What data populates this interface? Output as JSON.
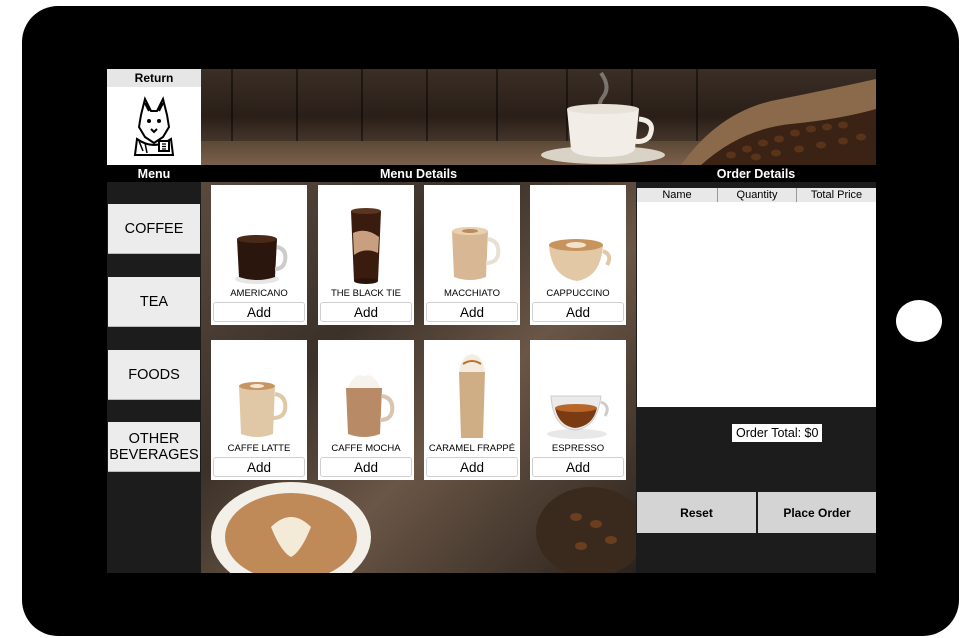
{
  "top": {
    "return_label": "Return"
  },
  "headers": {
    "menu": "Menu",
    "menu_details": "Menu Details",
    "order_details": "Order Details"
  },
  "categories": [
    "COFFEE",
    "TEA",
    "FOODS",
    "OTHER BEVERAGES"
  ],
  "items": [
    {
      "name": "AMERICANO",
      "add": "Add"
    },
    {
      "name": "THE BLACK TIE",
      "add": "Add"
    },
    {
      "name": "MACCHIATO",
      "add": "Add"
    },
    {
      "name": "CAPPUCCINO",
      "add": "Add"
    },
    {
      "name": "CAFFE LATTE",
      "add": "Add"
    },
    {
      "name": "CAFFE MOCHA",
      "add": "Add"
    },
    {
      "name": "CARAMEL FRAPPÉ",
      "add": "Add"
    },
    {
      "name": "ESPRESSO",
      "add": "Add"
    }
  ],
  "order": {
    "columns": [
      "Name",
      "Quantity",
      "Total Price"
    ],
    "total_label": "Order Total: $0",
    "reset_label": "Reset",
    "place_label": "Place Order"
  }
}
